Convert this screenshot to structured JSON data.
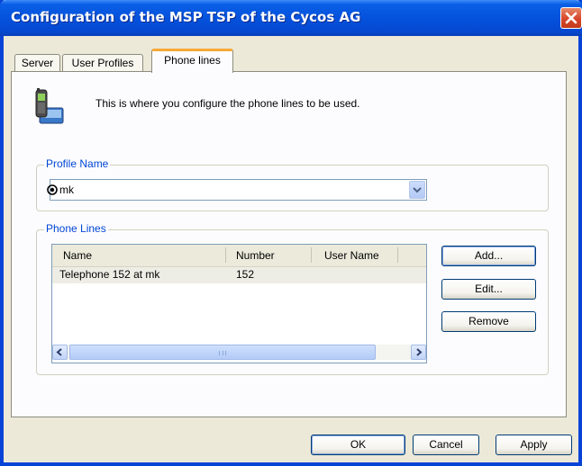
{
  "window": {
    "title": "Configuration of the MSP TSP of the Cycos AG"
  },
  "tabs": [
    {
      "label": "Server",
      "active": false
    },
    {
      "label": "User Profiles",
      "active": false
    },
    {
      "label": "Phone lines",
      "active": true
    }
  ],
  "intro": {
    "icon": "phone-computer-icon",
    "text": "This is where you configure the phone lines to be used."
  },
  "profile": {
    "group_label": "Profile Name",
    "selected": "mk",
    "icon": "radio-target-icon"
  },
  "phone_lines": {
    "group_label": "Phone Lines",
    "columns": [
      "Name",
      "Number",
      "User Name"
    ],
    "rows": [
      {
        "name": "Telephone 152 at mk",
        "number": "152",
        "user_name": ""
      }
    ],
    "buttons": {
      "add": "Add...",
      "edit": "Edit...",
      "remove": "Remove"
    }
  },
  "footer": {
    "ok": "OK",
    "cancel": "Cancel",
    "apply": "Apply"
  },
  "colors": {
    "titlebar": "#0552dc",
    "group_label": "#0046d5",
    "tab_highlight": "#f6a83a"
  }
}
